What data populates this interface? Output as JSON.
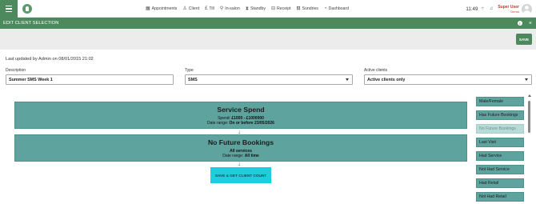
{
  "topbar": {
    "nav": [
      {
        "icon": "calendar-icon",
        "glyph": "▦",
        "label": "Appointments"
      },
      {
        "icon": "user-icon",
        "glyph": "♙",
        "label": "Client"
      },
      {
        "icon": "pound-icon",
        "glyph": "£",
        "label": "Till"
      },
      {
        "icon": "location-icon",
        "glyph": "⚲",
        "label": "In-salon"
      },
      {
        "icon": "hourglass-icon",
        "glyph": "⧗",
        "label": "Standby"
      },
      {
        "icon": "receipt-icon",
        "glyph": "⊟",
        "label": "Receipt"
      },
      {
        "icon": "basket-icon",
        "glyph": "⛾",
        "label": "Sundries"
      },
      {
        "icon": "dashboard-icon",
        "glyph": "◔",
        "label": "Dashboard"
      }
    ],
    "time": "11:49",
    "user_name": "Super User",
    "user_role": "Demo"
  },
  "dialog": {
    "title": "EDIT CLIENT SELECTION",
    "save_label": "SAVE",
    "last_updated": "Last updated by Admin on 08/01/2015 21:02"
  },
  "form": {
    "description_label": "Description",
    "description_value": "Summer SMS Week 1",
    "type_label": "Type",
    "type_value": "SMS",
    "active_label": "Active clients",
    "active_value": "Active clients only"
  },
  "criteria": [
    {
      "title": "Service Spend",
      "line1_prefix": "Spend: ",
      "line1_value": "£1000 - £1000000",
      "line2_prefix": "Date range: ",
      "line2_value": "On or before 23/05/2026"
    },
    {
      "title": "No Future Bookings",
      "line1_prefix": "",
      "line1_value": "All services",
      "line2_prefix": "Date range: ",
      "line2_value": "All time"
    }
  ],
  "count_button_label": "SAVE & GET CLIENT COUNT",
  "filters": [
    {
      "label": "Male/Female",
      "enabled": true
    },
    {
      "label": "Has Future Bookings",
      "enabled": true
    },
    {
      "label": "No Future Bookings",
      "enabled": false
    },
    {
      "label": "Last Visit",
      "enabled": true
    },
    {
      "label": "Had Service",
      "enabled": true
    },
    {
      "label": "Not Had Service",
      "enabled": true
    },
    {
      "label": "Had Retail",
      "enabled": true
    },
    {
      "label": "Not Had Retail",
      "enabled": true
    }
  ]
}
